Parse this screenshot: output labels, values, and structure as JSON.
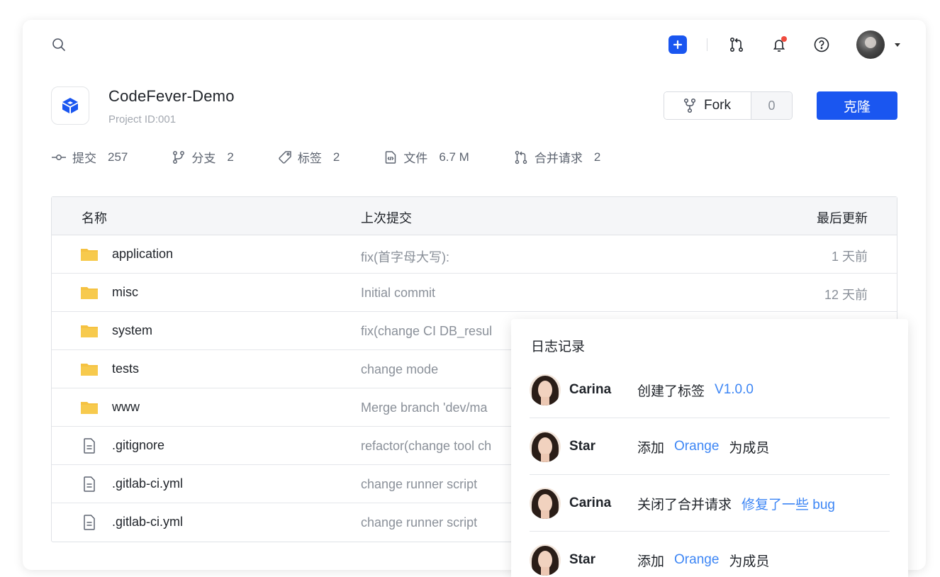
{
  "topbar": {
    "search_icon": "search-icon",
    "actions": [
      "plus-icon",
      "merge-request-icon",
      "bell-icon",
      "help-icon"
    ]
  },
  "project": {
    "name": "CodeFever-Demo",
    "id_label": "Project ID:001",
    "fork_label": "Fork",
    "fork_count": "0",
    "clone_label": "克隆"
  },
  "stats": [
    {
      "label": "提交",
      "value": "257"
    },
    {
      "label": "分支",
      "value": "2"
    },
    {
      "label": "标签",
      "value": "2"
    },
    {
      "label": "文件",
      "value": "6.7 M"
    },
    {
      "label": "合并请求",
      "value": "2"
    }
  ],
  "table": {
    "headers": {
      "name": "名称",
      "commit": "上次提交",
      "updated": "最后更新"
    },
    "rows": [
      {
        "type": "folder",
        "name": "application",
        "commit": "fix(首字母大写):",
        "updated": "1 天前"
      },
      {
        "type": "folder",
        "name": "misc",
        "commit": "Initial commit",
        "updated": "12 天前"
      },
      {
        "type": "folder",
        "name": "system",
        "commit": "fix(change CI DB_resul",
        "updated": ""
      },
      {
        "type": "folder",
        "name": "tests",
        "commit": "change mode",
        "updated": ""
      },
      {
        "type": "folder",
        "name": "www",
        "commit": "Merge branch 'dev/ma",
        "updated": ""
      },
      {
        "type": "file",
        "name": ".gitignore",
        "commit": "refactor(change tool ch",
        "updated": ""
      },
      {
        "type": "file",
        "name": ".gitlab-ci.yml",
        "commit": "change runner script",
        "updated": ""
      },
      {
        "type": "file",
        "name": ".gitlab-ci.yml",
        "commit": "change runner script",
        "updated": ""
      }
    ]
  },
  "activity": {
    "title": "日志记录",
    "items": [
      {
        "user": "Carina",
        "action": "创建了标签",
        "link": "V1.0.0",
        "suffix": ""
      },
      {
        "user": "Star",
        "action": "添加",
        "link": "Orange",
        "suffix": "为成员"
      },
      {
        "user": "Carina",
        "action": "关闭了合并请求",
        "link": "修复了一些 bug",
        "suffix": ""
      },
      {
        "user": "Star",
        "action": "添加",
        "link": "Orange",
        "suffix": "为成员"
      }
    ]
  },
  "colors": {
    "accent": "#1a56f0",
    "link": "#3d86f5",
    "folder": "#f5c242",
    "notify": "#f04b3e"
  }
}
